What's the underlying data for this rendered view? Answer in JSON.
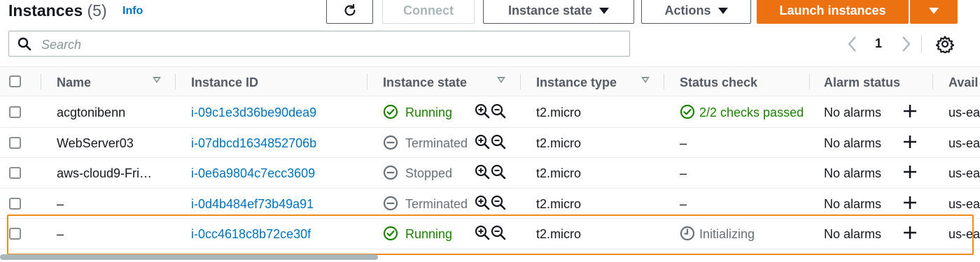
{
  "header": {
    "title": "Instances",
    "count": "(5)",
    "info_label": "Info",
    "refresh_icon": "refresh-icon",
    "connect_label": "Connect",
    "instance_state_label": "Instance state",
    "actions_label": "Actions",
    "launch_label": "Launch instances"
  },
  "search": {
    "placeholder": "Search"
  },
  "pagination": {
    "page": "1"
  },
  "columns": {
    "name": "Name",
    "instance_id": "Instance ID",
    "instance_state": "Instance state",
    "instance_type": "Instance type",
    "status_check": "Status check",
    "alarm_status": "Alarm status",
    "availability_zone": "Avail"
  },
  "rows": [
    {
      "name": "acgtonibenn",
      "instance_id": "i-09c1e3d36be90dea9",
      "state": "Running",
      "state_icon": "check-circle-icon",
      "type": "t2.micro",
      "status_check": "2/2 checks passed",
      "status_icon": "check-circle-icon",
      "alarm": "No alarms",
      "az": "us-ea"
    },
    {
      "name": "WebServer03",
      "instance_id": "i-07dbcd1634852706b",
      "state": "Terminated",
      "state_icon": "minus-circle-icon",
      "type": "t2.micro",
      "status_check": "–",
      "alarm": "No alarms",
      "az": "us-ea"
    },
    {
      "name": "aws-cloud9-Fri…",
      "instance_id": "i-0e6a9804c7ecc3609",
      "state": "Stopped",
      "state_icon": "minus-circle-icon",
      "type": "t2.micro",
      "status_check": "–",
      "alarm": "No alarms",
      "az": "us-ea"
    },
    {
      "name": "–",
      "instance_id": "i-0d4b484ef73b49a91",
      "state": "Terminated",
      "state_icon": "minus-circle-icon",
      "type": "t2.micro",
      "status_check": "–",
      "alarm": "No alarms",
      "az": "us-ea"
    },
    {
      "name": "–",
      "instance_id": "i-0cc4618c8b72ce30f",
      "state": "Running",
      "state_icon": "check-circle-icon",
      "type": "t2.micro",
      "status_check": "Initializing",
      "status_icon": "clock-icon",
      "alarm": "No alarms",
      "az": "us-ea"
    }
  ],
  "colors": {
    "primary": "#ec7211",
    "link": "#0073bb",
    "running": "#1d8102",
    "muted": "#687078",
    "highlight": "#f08c1e"
  }
}
